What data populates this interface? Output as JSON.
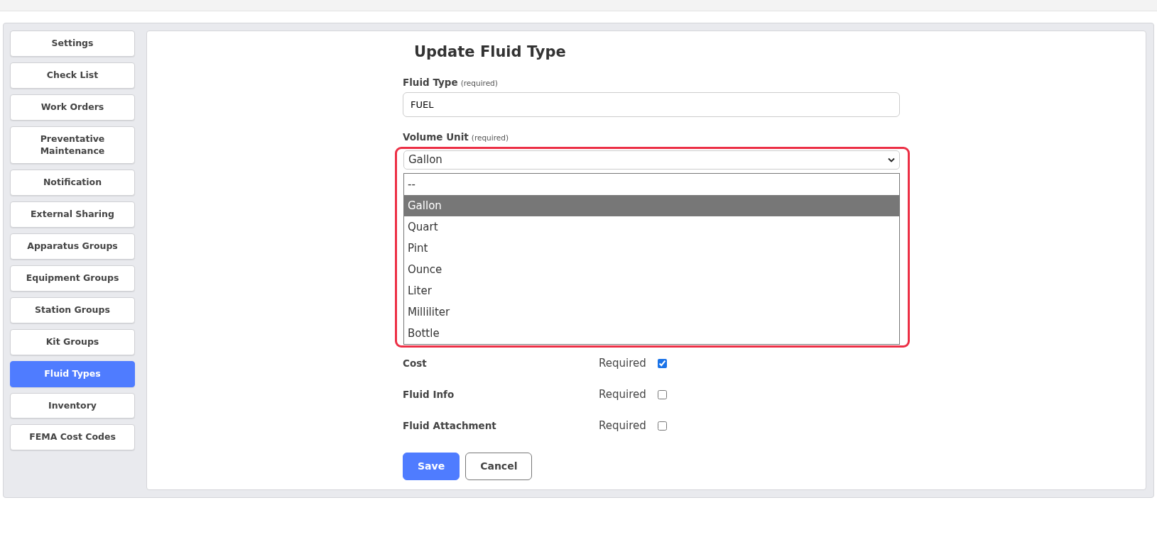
{
  "sidebar": {
    "items": [
      {
        "label": "Settings",
        "selected": false
      },
      {
        "label": "Check List",
        "selected": false
      },
      {
        "label": "Work Orders",
        "selected": false
      },
      {
        "label": "Preventative Maintenance",
        "selected": false
      },
      {
        "label": "Notification",
        "selected": false
      },
      {
        "label": "External Sharing",
        "selected": false
      },
      {
        "label": "Apparatus Groups",
        "selected": false
      },
      {
        "label": "Equipment Groups",
        "selected": false
      },
      {
        "label": "Station Groups",
        "selected": false
      },
      {
        "label": "Kit Groups",
        "selected": false
      },
      {
        "label": "Fluid Types",
        "selected": true
      },
      {
        "label": "Inventory",
        "selected": false
      },
      {
        "label": "FEMA Cost Codes",
        "selected": false
      }
    ]
  },
  "form": {
    "title": "Update Fluid Type",
    "fluid_type": {
      "label": "Fluid Type",
      "note": "(required)",
      "value": "FUEL"
    },
    "volume_unit": {
      "label": "Volume Unit",
      "note": "(required)",
      "value": "Gallon",
      "options": [
        {
          "label": "--",
          "selected": false
        },
        {
          "label": "Gallon",
          "selected": true
        },
        {
          "label": "Quart",
          "selected": false
        },
        {
          "label": "Pint",
          "selected": false
        },
        {
          "label": "Ounce",
          "selected": false
        },
        {
          "label": "Liter",
          "selected": false
        },
        {
          "label": "Milliliter",
          "selected": false
        },
        {
          "label": "Bottle",
          "selected": false
        }
      ]
    },
    "toggles": [
      {
        "label": "Cost",
        "text": "Required",
        "checked": true
      },
      {
        "label": "Fluid Info",
        "text": "Required",
        "checked": false
      },
      {
        "label": "Fluid Attachment",
        "text": "Required",
        "checked": false
      }
    ],
    "buttons": [
      {
        "label": "Save",
        "kind": "primary"
      },
      {
        "label": "Cancel",
        "kind": "secondary"
      }
    ]
  }
}
